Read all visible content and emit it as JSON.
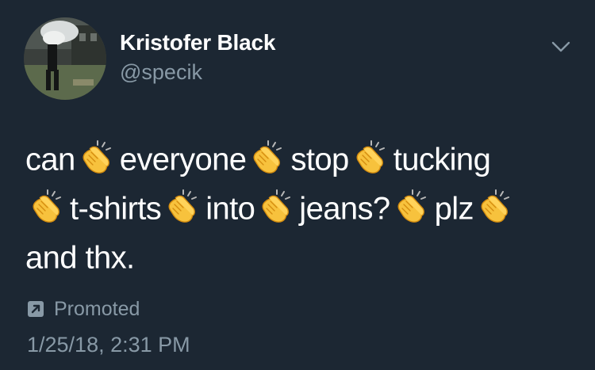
{
  "user": {
    "display_name": "Kristofer Black",
    "handle": "@specik"
  },
  "menu": {
    "icon": "chevron-down-icon"
  },
  "tweet": {
    "lines": [
      [
        "can",
        "clap",
        "everyone",
        "clap",
        "stop",
        "clap",
        "tucking"
      ],
      [
        "clap",
        "t-shirts",
        "clap",
        "into",
        "clap",
        "jeans?",
        "clap",
        "plz",
        "clap"
      ],
      [
        "and thx."
      ]
    ]
  },
  "promoted": {
    "icon": "promoted-arrow-icon",
    "label": "Promoted"
  },
  "timestamp": "1/25/18, 2:31 PM",
  "colors": {
    "background": "#1c2733",
    "primary_text": "#ffffff",
    "secondary_text": "#8899a6"
  }
}
